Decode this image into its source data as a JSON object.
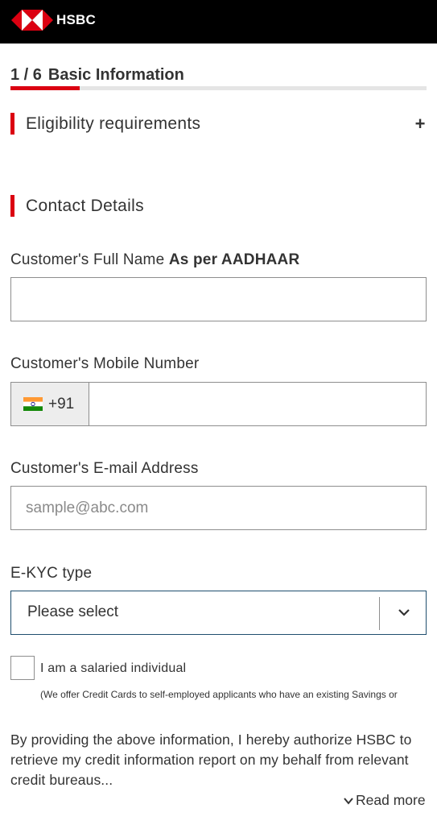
{
  "header": {
    "brand": "HSBC",
    "logo_icon": "hsbc-hexagon-logo",
    "colors": {
      "bar": "#000000",
      "brand_red": "#db0011"
    }
  },
  "progress": {
    "step_label": "1 / 6",
    "title": "Basic Information",
    "completed_fraction": 0.167
  },
  "sections": {
    "eligibility": {
      "title": "Eligibility requirements",
      "expand_icon": "plus-icon"
    },
    "contact": {
      "title": "Contact Details"
    }
  },
  "fields": {
    "full_name": {
      "label": "Customer's Full Name",
      "label_emphasis": "As per AADHAAR",
      "value": ""
    },
    "mobile": {
      "label": "Customer's Mobile Number",
      "country_code": "+91",
      "flag_icon": "india-flag-icon",
      "value": ""
    },
    "email": {
      "label": "Customer's E-mail Address",
      "placeholder": "sample@abc.com",
      "value": ""
    },
    "ekyc": {
      "label": "E-KYC type",
      "selected": "Please select",
      "dropdown_icon": "chevron-down-icon"
    }
  },
  "salaried": {
    "label": "I am a salaried individual",
    "checked": false,
    "note": "(We offer Credit Cards to self-employed applicants who have an existing Savings or"
  },
  "consent": {
    "text": "By providing the above information, I hereby authorize HSBC to retrieve my credit information report on my behalf from relevant credit bureaus...",
    "read_more": "Read more"
  }
}
